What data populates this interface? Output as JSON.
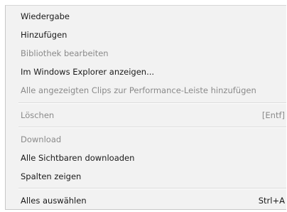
{
  "menu": {
    "items": [
      {
        "label": "Wiedergabe",
        "enabled": true
      },
      {
        "label": "Hinzufügen",
        "enabled": true
      },
      {
        "label": "Bibliothek bearbeiten",
        "enabled": false
      },
      {
        "label": "Im Windows Explorer anzeigen...",
        "enabled": true
      },
      {
        "label": "Alle angezeigten Clips zur Performance-Leiste hinzufügen",
        "enabled": false
      },
      {
        "label": "Löschen",
        "shortcut": "[Entf]",
        "enabled": false
      },
      {
        "label": "Download",
        "enabled": false
      },
      {
        "label": "Alle Sichtbaren downloaden",
        "enabled": true
      },
      {
        "label": "Spalten zeigen",
        "enabled": true
      },
      {
        "label": "Alles auswählen",
        "shortcut": "Strl+A",
        "enabled": true
      }
    ]
  }
}
